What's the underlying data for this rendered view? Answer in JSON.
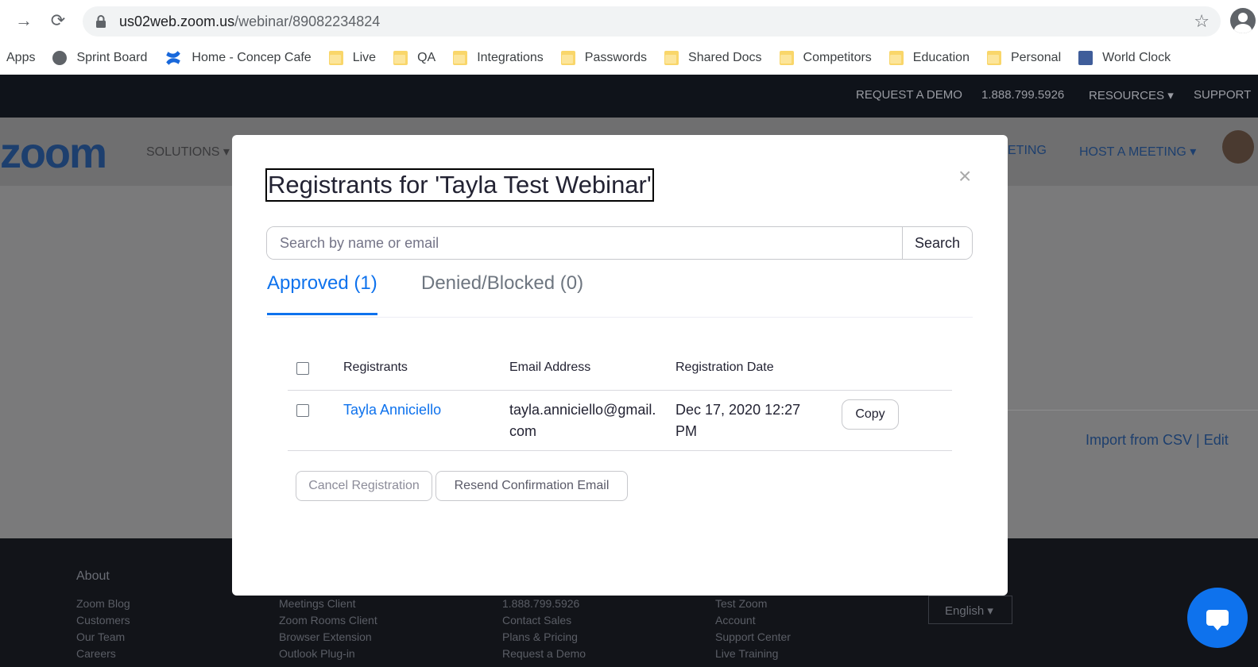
{
  "browser": {
    "url_host": "us02web.zoom.us",
    "url_path": "/webinar/89082234824",
    "bookmarks": [
      {
        "label": "Apps",
        "icon": "apps-icon"
      },
      {
        "label": "Sprint Board",
        "icon": "globe-icon"
      },
      {
        "label": "Home - Concep Cafe",
        "icon": "confluence-icon"
      },
      {
        "label": "Live",
        "icon": "folder-icon"
      },
      {
        "label": "QA",
        "icon": "folder-icon"
      },
      {
        "label": "Integrations",
        "icon": "folder-icon"
      },
      {
        "label": "Passwords",
        "icon": "folder-icon"
      },
      {
        "label": "Shared Docs",
        "icon": "folder-icon"
      },
      {
        "label": "Competitors",
        "icon": "folder-icon"
      },
      {
        "label": "Education",
        "icon": "folder-icon"
      },
      {
        "label": "Personal",
        "icon": "folder-icon"
      },
      {
        "label": "World Clock",
        "icon": "world-clock-icon"
      }
    ]
  },
  "topbar": {
    "request_demo": "REQUEST A DEMO",
    "phone": "1.888.799.5926",
    "resources": "RESOURCES",
    "support": "SUPPORT"
  },
  "mainnav": {
    "logo": "zoom",
    "solutions": "SOLUTIONS",
    "join_meeting_partial": "ETING",
    "host_meeting": "HOST A MEETING"
  },
  "page": {
    "import_csv": "Import from CSV",
    "separator": "|",
    "edit": "Edit"
  },
  "footer": {
    "about": "About",
    "col1": [
      "Zoom Blog",
      "Customers",
      "Our Team",
      "Careers"
    ],
    "col2": [
      "Meetings Client",
      "Zoom Rooms Client",
      "Browser Extension",
      "Outlook Plug-in"
    ],
    "col3": [
      "1.888.799.5926",
      "Contact Sales",
      "Plans & Pricing",
      "Request a Demo"
    ],
    "col4": [
      "Test Zoom",
      "Account",
      "Support Center",
      "Live Training"
    ],
    "language": "English"
  },
  "modal": {
    "title": "Registrants for 'Tayla Test Webinar'",
    "close": "×",
    "search_placeholder": "Search by name or email",
    "search_button": "Search",
    "tabs": {
      "approved": "Approved (1)",
      "denied": "Denied/Blocked (0)"
    },
    "table": {
      "headers": {
        "registrants": "Registrants",
        "email": "Email Address",
        "date": "Registration Date"
      },
      "rows": [
        {
          "name": "Tayla Anniciello",
          "email_line1": "tayla.anniciello@gmail.",
          "email_line2": "com",
          "date_line1": "Dec 17, 2020 12:27",
          "date_line2": "PM",
          "copy": "Copy"
        }
      ]
    },
    "cancel_registration": "Cancel Registration",
    "resend_email": "Resend Confirmation Email"
  },
  "colors": {
    "accent": "#0e72ed",
    "footer_bg": "#121419",
    "topbar_bg": "#0f131a"
  }
}
